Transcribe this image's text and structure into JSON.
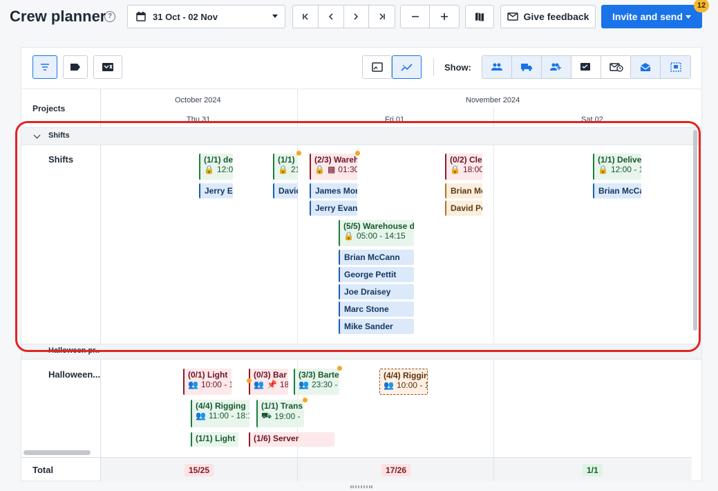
{
  "app": {
    "title": "Crew planner",
    "badge_count": "12"
  },
  "toolbar": {
    "date_range": "31 Oct - 02 Nov",
    "feedback_label": "Give feedback",
    "invite_label": "Invite and send"
  },
  "view": {
    "show_label": "Show:"
  },
  "grid": {
    "projects_header": "Projects",
    "months": [
      "October 2024",
      "November 2024"
    ],
    "days": [
      "Thu 31",
      "Fri 01",
      "Sat 02"
    ],
    "total_label": "Total",
    "totals": [
      "15/25",
      "17/26",
      "1/1"
    ]
  },
  "sections": {
    "shifts": {
      "group_label": "Shifts",
      "row_label": "Shifts"
    },
    "halloween": {
      "group_label": "Halloween pr...",
      "row_label": "Halloween..."
    }
  },
  "shift_cards": [
    {
      "title": "(1/1) de",
      "time": "12:0",
      "status": "green"
    },
    {
      "title": "(1/1)",
      "time": "21",
      "status": "green"
    },
    {
      "title": "(2/3) Wareh",
      "time": "01:30",
      "status": "red"
    },
    {
      "title": "(0/2) Cle",
      "time": "18:00",
      "status": "red"
    },
    {
      "title": "(1/1) Delive",
      "time": "12:00 - 1",
      "status": "green"
    },
    {
      "title": "(5/5) Warehouse d",
      "time": "05:00 - 14:15",
      "status": "green"
    }
  ],
  "people": {
    "c1": [
      "Jerry E"
    ],
    "c2": [
      "David"
    ],
    "c3": [
      "James Mor",
      "Jerry Evan"
    ],
    "c4": [
      "Brian Mc",
      "David Po"
    ],
    "c5": [
      "Brian McCa"
    ],
    "c6": [
      "Brian McCann",
      "George Pettit",
      "Joe Draisey",
      "Marc Stone",
      "Mike Sander"
    ]
  },
  "halloween_cards": [
    {
      "title": "(0/1) Light",
      "time": "10:00 - 1",
      "status": "red"
    },
    {
      "title": "(0/3) Bar",
      "time": "18",
      "status": "red"
    },
    {
      "title": "(3/3) Barte",
      "time": "23:30 -",
      "status": "green"
    },
    {
      "title": "(4/4) Riggin",
      "time": "10:00 - 1",
      "status": "orange"
    },
    {
      "title": "(4/4) Rigging",
      "time": "11:00 - 18:1",
      "status": "green"
    },
    {
      "title": "(1/1) Trans",
      "time": "19:00 -",
      "status": "green"
    },
    {
      "title": "(1/1) Light",
      "status": "green"
    },
    {
      "title": "(1/6) Server",
      "status": "red"
    }
  ],
  "colors": {
    "primary": "#1a73e8",
    "highlight": "#e02424",
    "badge": "#f5b82e"
  }
}
